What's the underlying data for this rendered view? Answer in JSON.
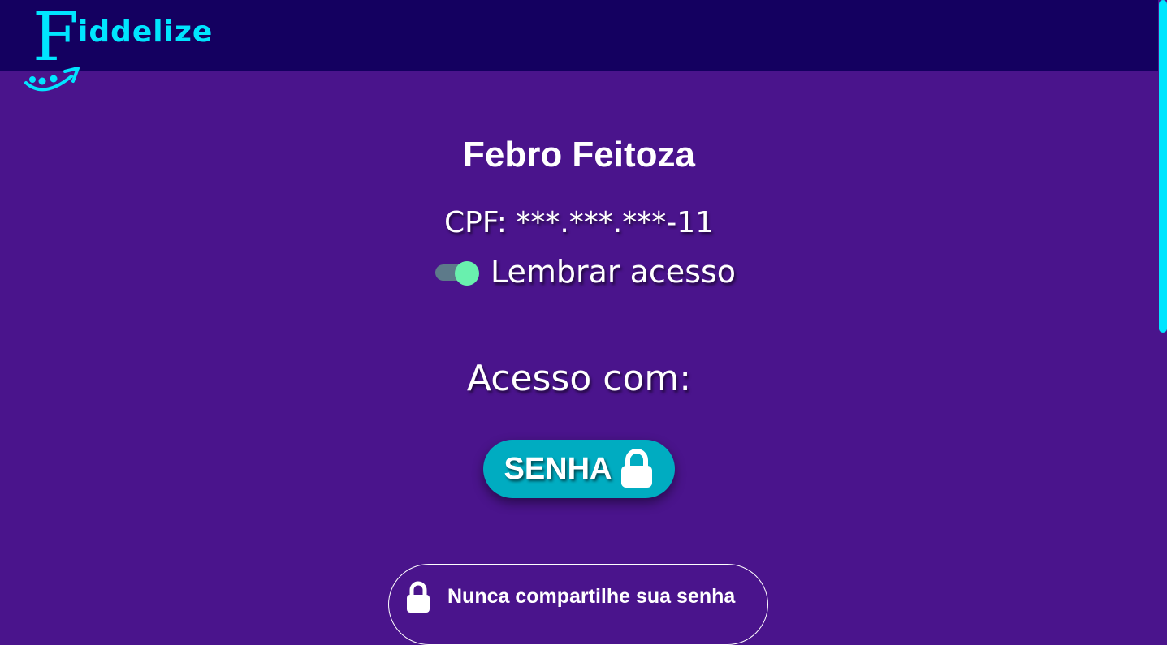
{
  "header": {
    "logo_initial": "F",
    "logo_text": "iddelize"
  },
  "profile": {
    "name": "Febro Feitoza",
    "cpf": "CPF: ***.***.***-11",
    "remember_label": "Lembrar acesso",
    "remember_enabled": true
  },
  "access": {
    "title": "Acesso com:",
    "senha_label": "SENHA",
    "senha_icon": "lock-icon"
  },
  "warning": {
    "icon": "lock-icon",
    "text": "Nunca compartilhe sua senha"
  },
  "colors": {
    "background": "#4a148c",
    "header": "#140060",
    "accent": "#00e5ff",
    "button": "#00acc1",
    "toggle_on": "#69f0ae"
  }
}
